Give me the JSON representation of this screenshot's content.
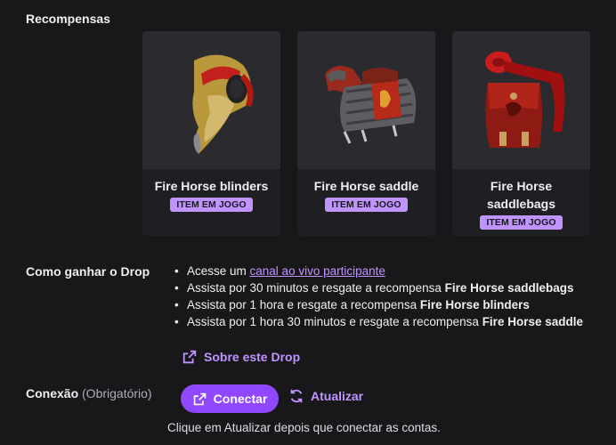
{
  "rewards": {
    "title": "Recompensas",
    "items": [
      {
        "name": "Fire Horse blinders",
        "badge": "ITEM EM JOGO",
        "icon": "fire-horse-blinders-image"
      },
      {
        "name": "Fire Horse saddle",
        "badge": "ITEM EM JOGO",
        "icon": "fire-horse-saddle-image"
      },
      {
        "name": "Fire Horse saddlebags",
        "badge": "ITEM EM JOGO",
        "icon": "fire-horse-saddlebags-image"
      }
    ]
  },
  "how_to": {
    "title": "Como ganhar o Drop",
    "step1_prefix": "Acesse um ",
    "step1_link": "canal ao vivo participante",
    "step2_text": "Assista por 30 minutos e resgate a recompensa ",
    "step2_bold": "Fire Horse saddlebags",
    "step3_text": "Assista por 1 hora e resgate a recompensa ",
    "step3_bold": "Fire Horse blinders",
    "step4_text": "Assista por 1 hora 30 minutos e resgate a recompensa ",
    "step4_bold": "Fire Horse saddle"
  },
  "about_link": "Sobre este Drop",
  "connection": {
    "label": "Conexão",
    "required": "(Obrigatório)",
    "connect_button": "Conectar",
    "refresh_button": "Atualizar",
    "help_text": "Clique em Atualizar depois que conectar as contas."
  },
  "colors": {
    "background": "#18181b",
    "card": "#1f1f23",
    "accent": "#9147ff",
    "accent_light": "#bf94ff"
  }
}
